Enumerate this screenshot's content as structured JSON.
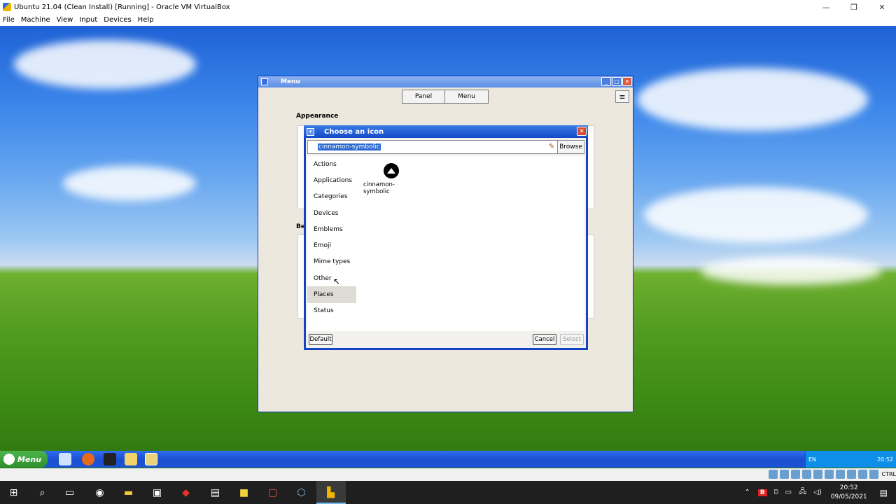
{
  "host": {
    "title": "Ubuntu 21.04 (Clean Install) [Running] - Oracle VM VirtualBox",
    "window_controls": [
      "—",
      "❐",
      "✕"
    ],
    "menu": [
      "File",
      "Machine",
      "View",
      "Input",
      "Devices",
      "Help"
    ]
  },
  "menu_window": {
    "title": "Menu",
    "tabs": [
      "Panel",
      "Menu"
    ],
    "hamburger": "≡",
    "appearance_heading": "Appearance",
    "behaviour_heading_partial": "Be"
  },
  "dialog": {
    "title": "Choose an icon",
    "search_value": "cinnamon-symbolic",
    "browse_label": "Browse",
    "categories": [
      "Actions",
      "Applications",
      "Categories",
      "Devices",
      "Emblems",
      "Emoji",
      "Mime types",
      "Other",
      "Places",
      "Status"
    ],
    "selected_category": "Places",
    "result_icon_label": "cinnamon-symbolic",
    "default_label": "Default",
    "cancel_label": "Cancel",
    "select_label": "Select"
  },
  "guest_taskbar": {
    "start_label": "Menu",
    "keyboard_layout": "EN",
    "time": "20:52"
  },
  "vbox_status": {
    "host_key": "CTRL"
  },
  "windows_taskbar": {
    "time": "20:52",
    "date": "09/05/2021"
  },
  "colors": {
    "xp_blue": "#1449c8",
    "selection": "#2a6ad2",
    "close_red": "#d64a2b"
  }
}
